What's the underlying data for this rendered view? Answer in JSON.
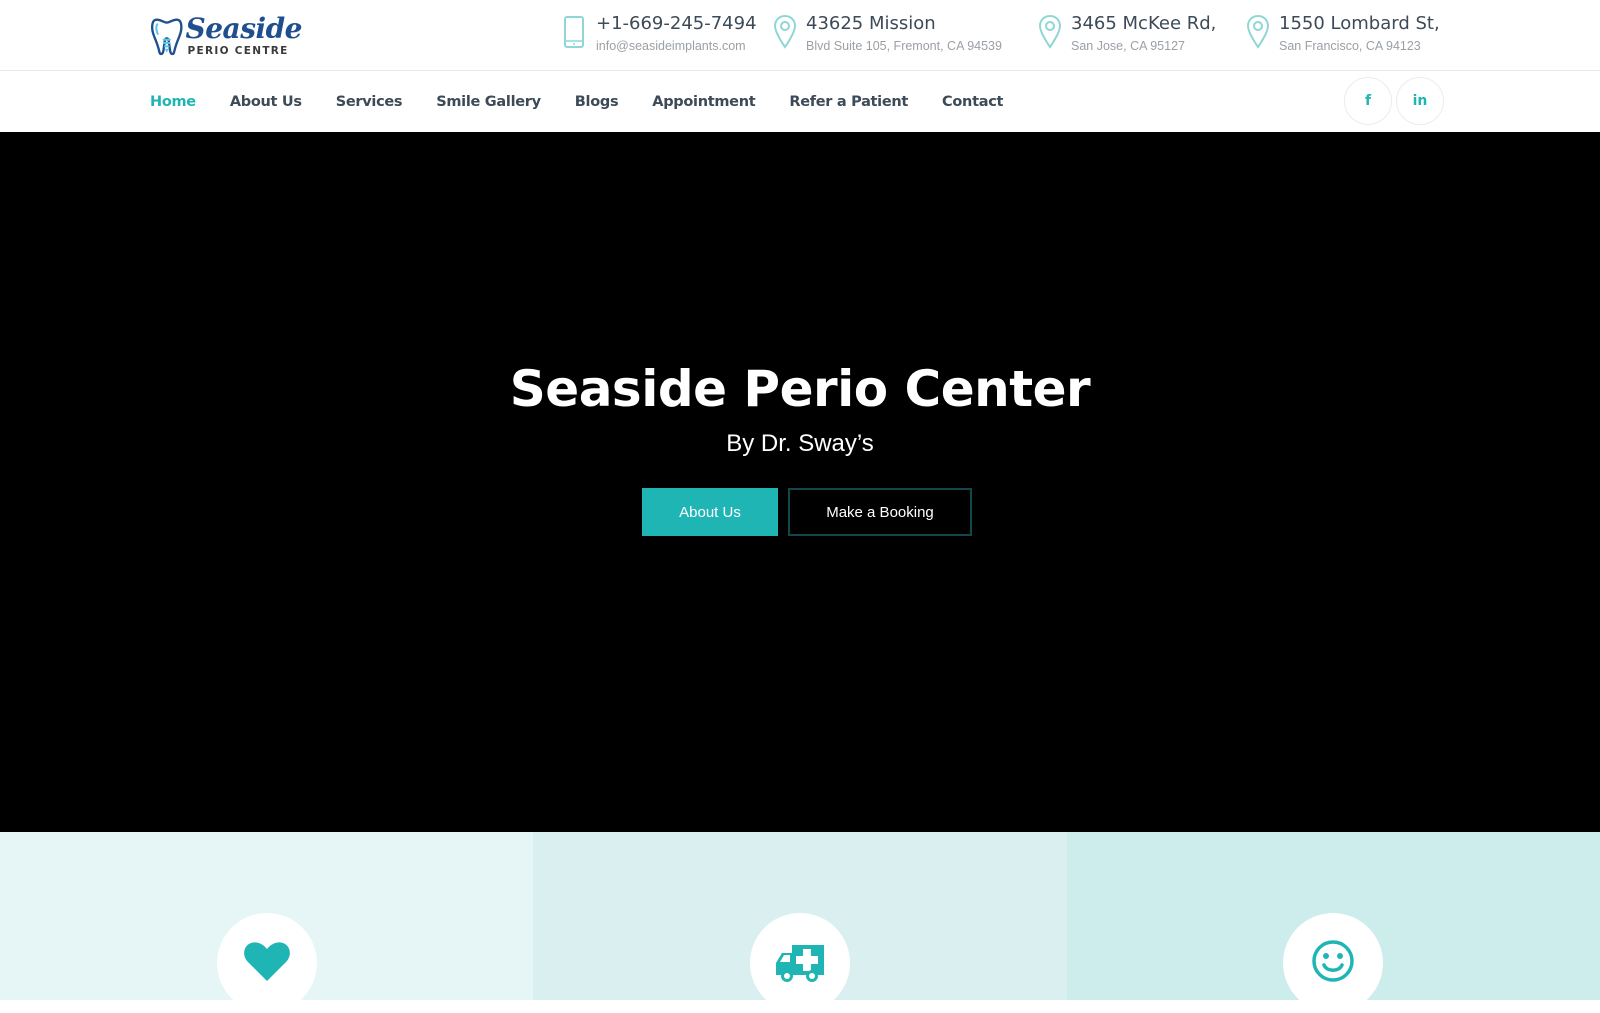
{
  "brand": {
    "logo_script": "Seaside",
    "logo_sub": "PERIO CENTRE",
    "accent_color": "#20b5b5",
    "logo_blue": "#1f4f8e"
  },
  "contacts": [
    {
      "icon": "mobile-phone-icon",
      "main": "+1-669-245-7494",
      "sub": "info@seasideimplants.com"
    },
    {
      "icon": "map-pin-icon",
      "main": "43625 Mission",
      "sub": "Blvd Suite 105, Fremont, CA 94539"
    },
    {
      "icon": "map-pin-icon",
      "main": "3465 McKee Rd,",
      "sub": "San Jose, CA 95127"
    },
    {
      "icon": "map-pin-icon",
      "main": "1550 Lombard St,",
      "sub": "San Francisco, CA 94123"
    }
  ],
  "nav": {
    "items": [
      {
        "label": "Home",
        "active": true
      },
      {
        "label": "About Us"
      },
      {
        "label": "Services"
      },
      {
        "label": "Smile Gallery"
      },
      {
        "label": "Blogs"
      },
      {
        "label": "Appointment"
      },
      {
        "label": "Refer a Patient"
      },
      {
        "label": "Contact"
      }
    ],
    "social": [
      {
        "name": "facebook",
        "glyph": "f"
      },
      {
        "name": "linkedin",
        "glyph": "in"
      }
    ]
  },
  "hero": {
    "title": "Seaside Perio Center",
    "subtitle": "By Dr. Sway’s",
    "primary_button": "About Us",
    "secondary_button": "Make a Booking"
  },
  "features": [
    {
      "icon": "heart-icon",
      "bg": "#e6f5f5"
    },
    {
      "icon": "ambulance-icon",
      "bg": "#daf0f0"
    },
    {
      "icon": "smiley-face-icon",
      "bg": "#cdecec"
    }
  ]
}
